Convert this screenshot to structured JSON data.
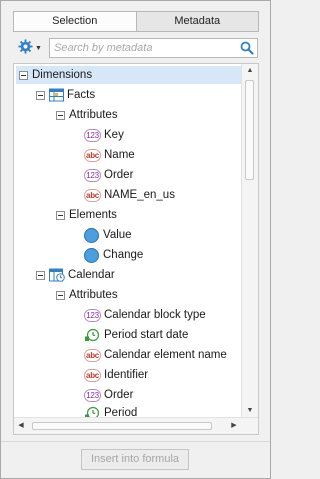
{
  "tabs": [
    {
      "label": "Selection",
      "active": true
    },
    {
      "label": "Metadata",
      "active": false
    }
  ],
  "toolbar": {
    "settings_icon": "gear-icon",
    "search_placeholder": "Search by metadata",
    "search_value": "",
    "search_icon": "magnifier-icon"
  },
  "tree": {
    "root": {
      "label": "Dimensions",
      "expanded": true
    },
    "facts": {
      "label": "Facts",
      "attributes_label": "Attributes",
      "attributes": [
        {
          "label": "Key",
          "type": "number"
        },
        {
          "label": "Name",
          "type": "string"
        },
        {
          "label": "Order",
          "type": "number"
        },
        {
          "label": "NAME_en_us",
          "type": "string"
        }
      ],
      "elements_label": "Elements",
      "elements": [
        {
          "label": "Value"
        },
        {
          "label": "Change"
        }
      ]
    },
    "calendar": {
      "label": "Calendar",
      "attributes_label": "Attributes",
      "attributes": [
        {
          "label": "Calendar block type",
          "type": "number"
        },
        {
          "label": "Period start date",
          "type": "date"
        },
        {
          "label": "Calendar element name",
          "type": "string"
        },
        {
          "label": "Identifier",
          "type": "string"
        },
        {
          "label": "Order",
          "type": "number"
        },
        {
          "label": "Period",
          "type": "date"
        }
      ]
    }
  },
  "colors": {
    "selected_row": "#d6e8f7",
    "number_badge": "#8a2aa8",
    "string_badge": "#c0392b",
    "date_badge": "#3a9a3a",
    "element_circle": "#4a9fe0",
    "accent": "#2f80c8"
  },
  "footer": {
    "insert_label": "Insert into formula",
    "insert_enabled": false
  }
}
